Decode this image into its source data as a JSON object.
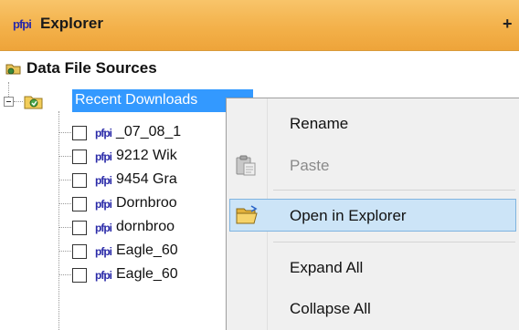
{
  "header": {
    "app_badge": "pfpi",
    "title": "Explorer",
    "pin_glyph": "+"
  },
  "tree": {
    "root_label": "Data File Sources",
    "selected_node": "Recent Downloads",
    "leaf_badge": "pfpi",
    "items": [
      {
        "label": "_07_08_1"
      },
      {
        "label": "9212 Wik"
      },
      {
        "label": "9454 Gra"
      },
      {
        "label": "Dornbroo"
      },
      {
        "label": "dornbroo"
      },
      {
        "label": "Eagle_60"
      },
      {
        "label": "Eagle_60"
      }
    ]
  },
  "context_menu": {
    "items": [
      {
        "label": "Rename",
        "enabled": true
      },
      {
        "label": "Paste",
        "enabled": false,
        "icon": "clipboard-paste-icon"
      },
      {
        "label": "Open in Explorer",
        "enabled": true,
        "icon": "open-folder-icon",
        "highlighted": true
      },
      {
        "label": "Expand All",
        "enabled": true
      },
      {
        "label": "Collapse All",
        "enabled": true
      }
    ]
  },
  "colors": {
    "header_bg": "#f3b14a",
    "selection_bg": "#3399ff",
    "menu_bg": "#f0f0f0",
    "menu_highlight": "#cce4f7",
    "badge_text": "#2a2aa8"
  }
}
